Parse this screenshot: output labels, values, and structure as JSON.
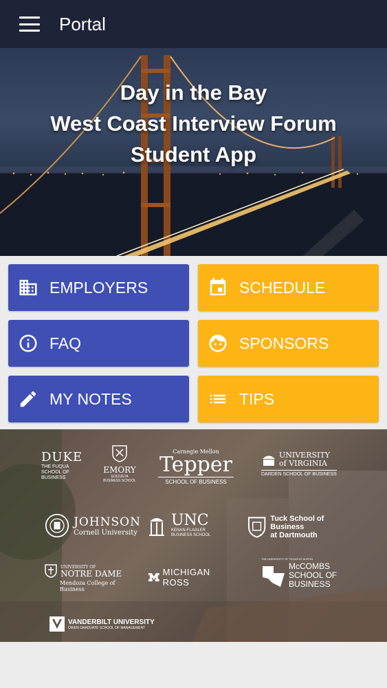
{
  "appbar": {
    "title": "Portal",
    "menu_icon": "hamburger-menu-icon"
  },
  "hero": {
    "line1": "Day in the Bay",
    "line2": "West Coast Interview Forum",
    "line3": "Student App"
  },
  "tiles": [
    {
      "label": "EMPLOYERS",
      "icon": "building-icon",
      "color": "#3f4fb4"
    },
    {
      "label": "SCHEDULE",
      "icon": "calendar-icon",
      "color": "#fcb515"
    },
    {
      "label": "FAQ",
      "icon": "info-icon",
      "color": "#3f4fb4"
    },
    {
      "label": "SPONSORS",
      "icon": "face-icon",
      "color": "#fcb515"
    },
    {
      "label": "MY NOTES",
      "icon": "pencil-icon",
      "color": "#3f4fb4"
    },
    {
      "label": "TIPS",
      "icon": "list-icon",
      "color": "#fcb515"
    }
  ],
  "logos": {
    "duke": {
      "name": "DUKE",
      "sub": "THE FUQUA SCHOOL OF BUSINESS"
    },
    "emory": {
      "name": "EMORY",
      "sub": "GOIZUETA BUSINESS SCHOOL"
    },
    "tepper": {
      "top": "Carnegie Mellon",
      "name": "Tepper",
      "sub": "SCHOOL OF BUSINESS"
    },
    "uva": {
      "name": "UNIVERSITY of VIRGINIA",
      "sub": "DARDEN SCHOOL OF BUSINESS"
    },
    "johnson": {
      "name": "JOHNSON",
      "sub": "Cornell University"
    },
    "unc": {
      "name": "UNC",
      "sub": "KENAN-FLAGLER BUSINESS SCHOOL"
    },
    "tuck": {
      "name": "Tuck School of Business",
      "sub": "at Dartmouth"
    },
    "notre_dame": {
      "top": "UNIVERSITY OF",
      "name": "NOTRE DAME",
      "sub": "Mendoza College of Business"
    },
    "michigan": {
      "name": "MICHIGAN ROSS"
    },
    "mccombs": {
      "top": "THE UNIVERSITY OF TEXAS AT AUSTIN",
      "name": "McCOMBS SCHOOL OF BUSINESS"
    },
    "vanderbilt": {
      "name": "VANDERBILT UNIVERSITY",
      "sub": "OWEN GRADUATE SCHOOL OF MANAGEMENT"
    }
  }
}
